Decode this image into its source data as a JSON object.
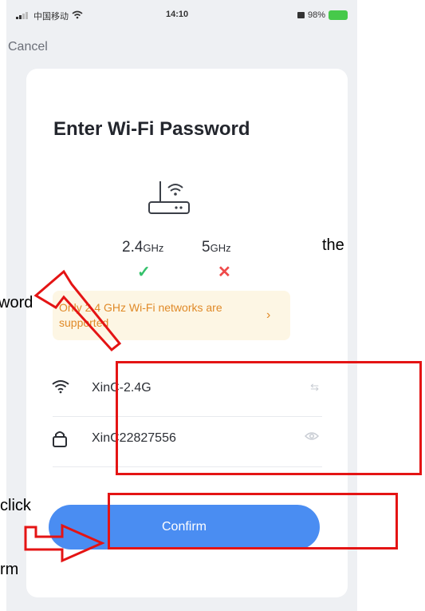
{
  "status_bar": {
    "carrier": "中国移动",
    "time": "14:10",
    "battery": "98%"
  },
  "nav": {
    "cancel_label": "Cancel"
  },
  "page": {
    "title": "Enter Wi-Fi Password"
  },
  "bands": [
    {
      "label": "2.4",
      "unit": "GHz",
      "supported": true
    },
    {
      "label": "5",
      "unit": "GHz",
      "supported": false
    }
  ],
  "notice": {
    "text": "Only 2.4 GHz Wi-Fi networks are supported",
    "chevron": "›"
  },
  "wifi": {
    "ssid": "XinC-2.4G",
    "switch_icon": "⇆"
  },
  "password": {
    "value": "XinC22827556",
    "eye_icon": "eye-icon"
  },
  "confirm": {
    "label": "Confirm"
  },
  "annotation_text": {
    "line1": "the",
    "line2": "word",
    "line3": "click",
    "line4": "rm"
  },
  "colors": {
    "accent": "#4a8df2",
    "annotation": "#e41414",
    "notice_bg": "#fdf6e4",
    "notice_text": "#e08a28"
  }
}
